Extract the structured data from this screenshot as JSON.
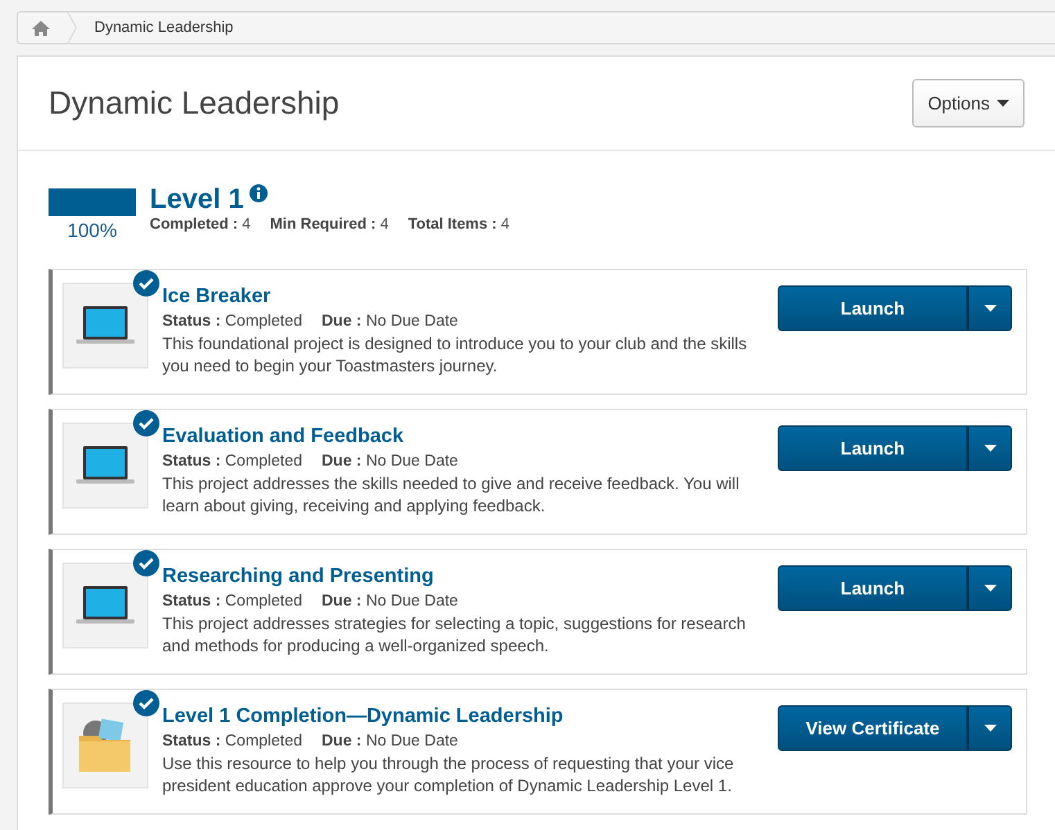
{
  "breadcrumb": {
    "items": [
      "Dynamic Leadership"
    ]
  },
  "page": {
    "title": "Dynamic Leadership",
    "options_button": "Options"
  },
  "level": {
    "title": "Level 1",
    "level": 1,
    "percent": "100%",
    "stats": [
      {
        "label": "Completed :",
        "value": "4"
      },
      {
        "label": "Min Required :",
        "value": "4"
      },
      {
        "label": "Total Items :",
        "value": "4"
      }
    ]
  },
  "items": [
    {
      "kind": "course",
      "title": "Ice Breaker",
      "completed": true,
      "status_label": "Status :",
      "status": "Completed",
      "due_label": "Due :",
      "due": "No Due Date",
      "description": "This foundational project is designed to introduce you to your club and the skills you need to begin your Toastmasters journey.",
      "button": "Launch"
    },
    {
      "kind": "course",
      "title": "Evaluation and Feedback",
      "completed": true,
      "status_label": "Status :",
      "status": "Completed",
      "due_label": "Due :",
      "due": "No Due Date",
      "description": "This project addresses the skills needed to give and receive feedback. You will learn about giving, receiving and applying feedback.",
      "button": "Launch"
    },
    {
      "kind": "course",
      "title": "Researching and Presenting",
      "completed": true,
      "status_label": "Status :",
      "status": "Completed",
      "due_label": "Due :",
      "due": "No Due Date",
      "description": "This project addresses strategies for selecting a topic, suggestions for research and methods for producing a well-organized speech.",
      "button": "Launch"
    },
    {
      "kind": "resource",
      "title": "Level 1 Completion—Dynamic Leadership",
      "completed": true,
      "status_label": "Status :",
      "status": "Completed",
      "due_label": "Due :",
      "due": "No Due Date",
      "description": "Use this resource to help you through the process of requesting that your vice president education approve your completion of Dynamic Leadership Level 1.",
      "button": "View Certificate"
    }
  ]
}
